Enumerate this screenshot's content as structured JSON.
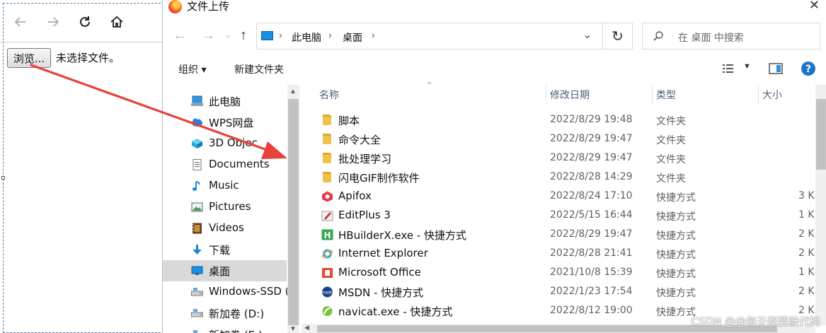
{
  "browser": {
    "file_input": {
      "button_label": "浏览...",
      "status_text": "未选择文件。"
    }
  },
  "dialog": {
    "title": "文件上传",
    "breadcrumb": [
      "此电脑",
      "桌面"
    ],
    "search_placeholder": "在 桌面 中搜索",
    "commands": {
      "organize": "组织 ▾",
      "new_folder": "新建文件夹"
    },
    "nav_items": [
      {
        "label": "此电脑",
        "icon": "computer-icon"
      },
      {
        "label": "WPS网盘",
        "icon": "cloud-icon"
      },
      {
        "label": "3D Objec",
        "icon": "cube-icon"
      },
      {
        "label": "Documents",
        "icon": "document-icon"
      },
      {
        "label": "Music",
        "icon": "music-note-icon"
      },
      {
        "label": "Pictures",
        "icon": "picture-icon"
      },
      {
        "label": "Videos",
        "icon": "film-icon"
      },
      {
        "label": "下载",
        "icon": "download-arrow-icon"
      },
      {
        "label": "桌面",
        "icon": "desktop-icon",
        "selected": true
      },
      {
        "label": "Windows-SSD (",
        "icon": "drive-icon"
      },
      {
        "label": "新加卷 (D:)",
        "icon": "drive-icon"
      },
      {
        "label": "新加卷 (E:)",
        "icon": "drive-icon"
      }
    ],
    "columns": {
      "name": "名称",
      "modified": "修改日期",
      "type": "类型",
      "size": "大小"
    },
    "files": [
      {
        "name": "脚本",
        "date": "2022/8/29 19:48",
        "type": "文件夹",
        "size": "",
        "icon": "folder-icon"
      },
      {
        "name": "命令大全",
        "date": "2022/8/29 19:47",
        "type": "文件夹",
        "size": "",
        "icon": "folder-icon"
      },
      {
        "name": "批处理学习",
        "date": "2022/8/29 19:47",
        "type": "文件夹",
        "size": "",
        "icon": "folder-icon"
      },
      {
        "name": "闪电GIF制作软件",
        "date": "2022/8/28 14:29",
        "type": "文件夹",
        "size": "",
        "icon": "folder-icon"
      },
      {
        "name": "Apifox",
        "date": "2022/8/24 17:10",
        "type": "快捷方式",
        "size": "3 K",
        "icon": "apifox-icon"
      },
      {
        "name": "EditPlus 3",
        "date": "2022/5/15 16:44",
        "type": "快捷方式",
        "size": "1 K",
        "icon": "editplus-icon"
      },
      {
        "name": "HBuilderX.exe - 快捷方式",
        "date": "2022/8/29 19:47",
        "type": "快捷方式",
        "size": "2 K",
        "icon": "hbuilder-icon"
      },
      {
        "name": "Internet Explorer",
        "date": "2022/8/28 21:41",
        "type": "快捷方式",
        "size": "2 K",
        "icon": "ie-icon"
      },
      {
        "name": "Microsoft Office",
        "date": "2021/10/8 15:39",
        "type": "快捷方式",
        "size": "1 K",
        "icon": "office-icon"
      },
      {
        "name": "MSDN - 快捷方式",
        "date": "2022/1/23 17:54",
        "type": "快捷方式",
        "size": "2 K",
        "icon": "msdn-icon"
      },
      {
        "name": "navicat.exe - 快捷方式",
        "date": "2022/8/12 19:00",
        "type": "快捷方式",
        "size": "2 K",
        "icon": "navicat-icon"
      }
    ]
  },
  "watermark": "CSDN @@每天都要敲代码",
  "colors": {
    "accent": "#0078d7",
    "arrow": "#e8403a",
    "selected_bg": "#d9d9d9"
  }
}
